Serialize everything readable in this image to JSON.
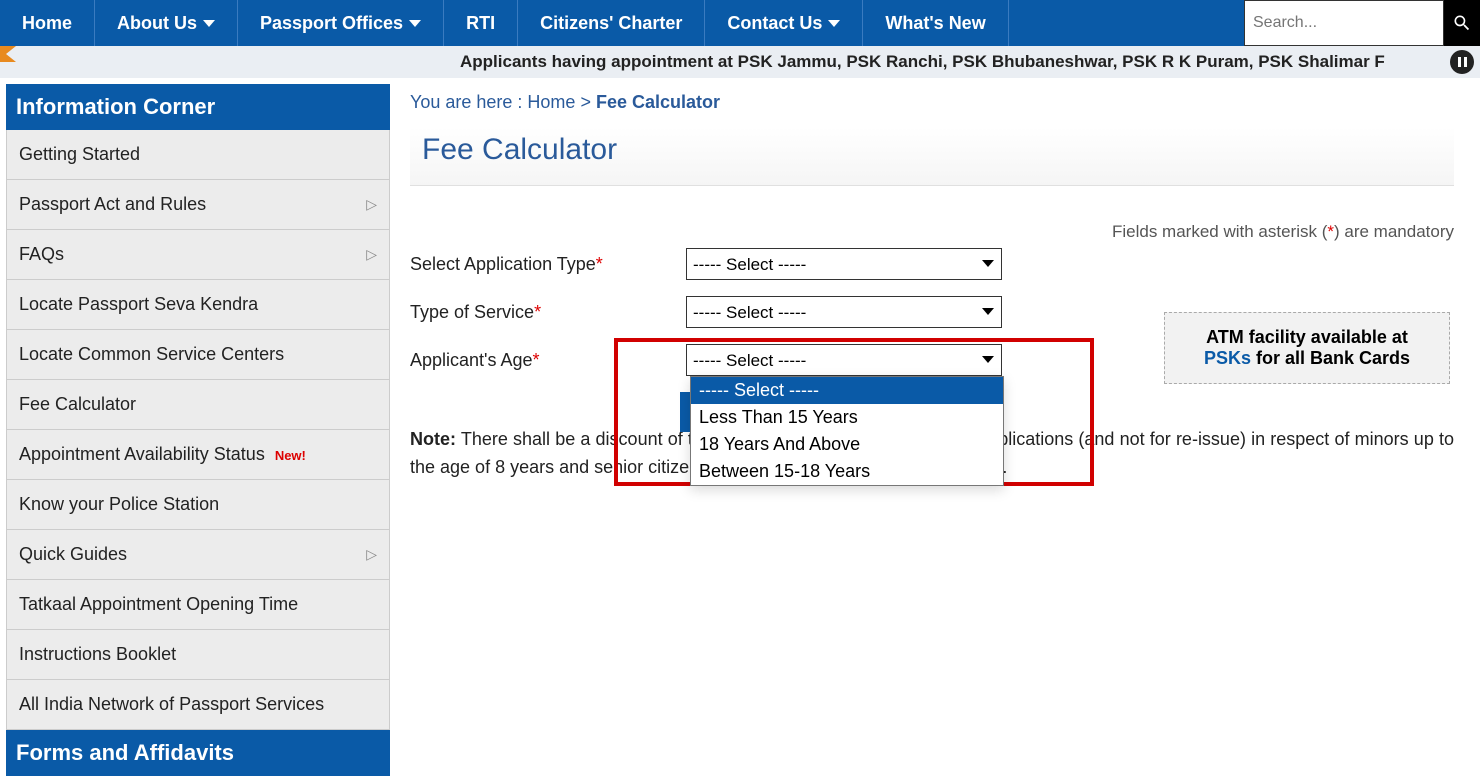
{
  "nav": {
    "items": [
      {
        "label": "Home",
        "has_caret": false
      },
      {
        "label": "About Us",
        "has_caret": true
      },
      {
        "label": "Passport Offices",
        "has_caret": true
      },
      {
        "label": "RTI",
        "has_caret": false
      },
      {
        "label": "Citizens' Charter",
        "has_caret": false
      },
      {
        "label": "Contact Us",
        "has_caret": true
      },
      {
        "label": "What's New",
        "has_caret": false
      }
    ],
    "search_placeholder": "Search..."
  },
  "marquee": "Applicants having appointment at PSK Jammu, PSK Ranchi, PSK Bhubaneshwar, PSK R K Puram, PSK Shalimar F",
  "sidebar": {
    "header1": "Information Corner",
    "items": [
      {
        "label": "Getting Started",
        "chev": false
      },
      {
        "label": "Passport Act and Rules",
        "chev": true
      },
      {
        "label": "FAQs",
        "chev": true
      },
      {
        "label": "Locate Passport Seva Kendra",
        "chev": false
      },
      {
        "label": "Locate Common Service Centers",
        "chev": false
      },
      {
        "label": "Fee Calculator",
        "chev": false
      },
      {
        "label": "Appointment Availability Status",
        "chev": false,
        "new": true
      },
      {
        "label": "Know your Police Station",
        "chev": false
      },
      {
        "label": "Quick Guides",
        "chev": true
      },
      {
        "label": "Tatkaal Appointment Opening Time",
        "chev": false
      },
      {
        "label": "Instructions Booklet",
        "chev": false
      },
      {
        "label": "All India Network of Passport Services",
        "chev": false
      }
    ],
    "header2": "Forms and Affidavits",
    "new_label": "New!"
  },
  "breadcrumb": {
    "prefix": "You are here : ",
    "home": "Home",
    "sep": " > ",
    "current": "Fee Calculator"
  },
  "page_title": "Fee Calculator",
  "mandatory": {
    "pre": "Fields marked with asterisk (",
    "ast": "*",
    "post": ") are mandatory"
  },
  "atm": {
    "line1": "ATM facility available at",
    "psk": "PSKs",
    "line2": "  for all Bank Cards"
  },
  "form": {
    "app_type": {
      "label": "Select Application Type",
      "value": "----- Select -----"
    },
    "service": {
      "label": "Type of Service",
      "value": "----- Select -----"
    },
    "age": {
      "label": "Applicant's Age",
      "value": "----- Select -----"
    }
  },
  "age_options": [
    "----- Select -----",
    "Less Than 15 Years",
    "18 Years And Above",
    "Between 15-18 Years"
  ],
  "note": {
    "label": "Note:",
    "text": " There shall be a discount of ten percent in passport fee for fresh applications (and not for re-issue) in respect of minors up to the age of 8 years and senior citizens (persons above the age of 60 years)."
  }
}
